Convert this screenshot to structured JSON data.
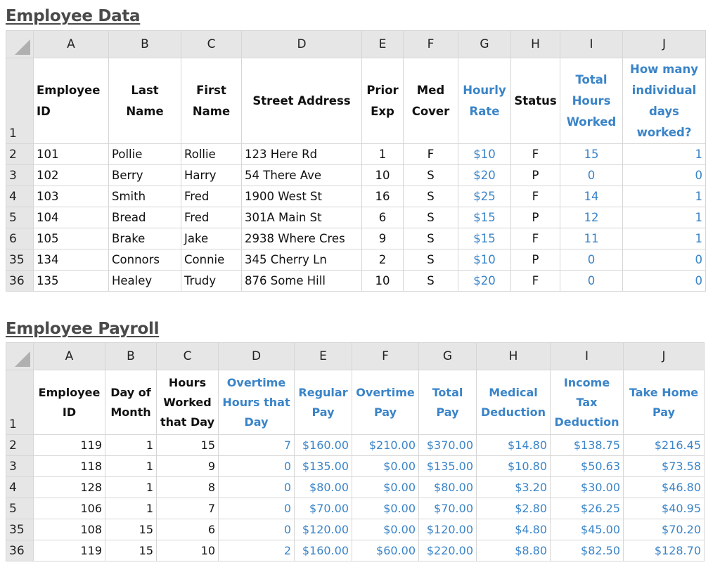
{
  "employee_data": {
    "title": "Employee Data",
    "columns": [
      "A",
      "B",
      "C",
      "D",
      "E",
      "F",
      "G",
      "H",
      "I",
      "J"
    ],
    "headers": [
      "Employee ID",
      "Last Name",
      "First Name",
      "Street Address",
      "Prior Exp",
      "Med Cover",
      "Hourly Rate",
      "Status",
      "Total Hours Worked",
      "How many individual days worked?"
    ],
    "header_row_number": "1",
    "rows": [
      {
        "row": "2",
        "cells": [
          "101",
          "Pollie",
          "Rollie",
          "123 Here Rd",
          "1",
          "F",
          "$10",
          "F",
          "15",
          "1"
        ]
      },
      {
        "row": "3",
        "cells": [
          "102",
          "Berry",
          "Harry",
          "54 There Ave",
          "10",
          "S",
          "$20",
          "P",
          "0",
          "0"
        ]
      },
      {
        "row": "4",
        "cells": [
          "103",
          "Smith",
          "Fred",
          "1900 West St",
          "16",
          "S",
          "$25",
          "F",
          "14",
          "1"
        ]
      },
      {
        "row": "5",
        "cells": [
          "104",
          "Bread",
          "Fred",
          "301A Main St",
          "6",
          "S",
          "$15",
          "P",
          "12",
          "1"
        ]
      },
      {
        "row": "6",
        "cells": [
          "105",
          "Brake",
          "Jake",
          "2938 Where Cres",
          "9",
          "S",
          "$15",
          "F",
          "11",
          "1"
        ]
      },
      {
        "row": "35",
        "cells": [
          "134",
          "Connors",
          "Connie",
          "345 Cherry Ln",
          "2",
          "S",
          "$10",
          "P",
          "0",
          "0"
        ]
      },
      {
        "row": "36",
        "cells": [
          "135",
          "Healey",
          "Trudy",
          "876 Some Hill",
          "10",
          "S",
          "$20",
          "F",
          "0",
          "0"
        ]
      }
    ]
  },
  "employee_payroll": {
    "title": "Employee Payroll",
    "columns": [
      "A",
      "B",
      "C",
      "D",
      "E",
      "F",
      "G",
      "H",
      "I",
      "J"
    ],
    "headers": [
      "Employee ID",
      "Day of Month",
      "Hours Worked that Day",
      "Overtime Hours that Day",
      "Regular Pay",
      "Overtime Pay",
      "Total Pay",
      "Medical Deduction",
      "Income Tax Deduction",
      "Take Home Pay"
    ],
    "header_row_number": "1",
    "rows": [
      {
        "row": "2",
        "cells": [
          "119",
          "1",
          "15",
          "7",
          "$160.00",
          "$210.00",
          "$370.00",
          "$14.80",
          "$138.75",
          "$216.45"
        ]
      },
      {
        "row": "3",
        "cells": [
          "118",
          "1",
          "9",
          "0",
          "$135.00",
          "$0.00",
          "$135.00",
          "$10.80",
          "$50.63",
          "$73.58"
        ]
      },
      {
        "row": "4",
        "cells": [
          "128",
          "1",
          "8",
          "0",
          "$80.00",
          "$0.00",
          "$80.00",
          "$3.20",
          "$30.00",
          "$46.80"
        ]
      },
      {
        "row": "5",
        "cells": [
          "106",
          "1",
          "7",
          "0",
          "$70.00",
          "$0.00",
          "$70.00",
          "$2.80",
          "$26.25",
          "$40.95"
        ]
      },
      {
        "row": "35",
        "cells": [
          "108",
          "15",
          "6",
          "0",
          "$120.00",
          "$0.00",
          "$120.00",
          "$4.80",
          "$45.00",
          "$70.20"
        ]
      },
      {
        "row": "36",
        "cells": [
          "119",
          "15",
          "10",
          "2",
          "$160.00",
          "$60.00",
          "$220.00",
          "$8.80",
          "$82.50",
          "$128.70"
        ]
      }
    ]
  },
  "colors": {
    "formula_blue": "#3a84c8",
    "header_gray": "#e6e6e6",
    "title_gray": "#4a4a4a"
  }
}
